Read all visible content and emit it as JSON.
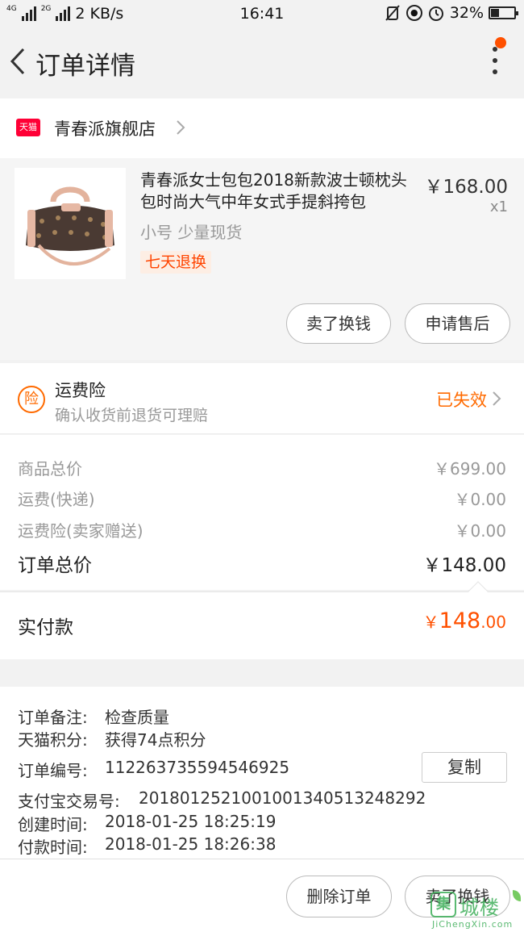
{
  "status_bar": {
    "network_left": "4G",
    "network_right": "2G",
    "speed": "2 KB/s",
    "time": "16:41",
    "battery": "32%",
    "icons": [
      "mute-icon",
      "rotation-lock-icon",
      "alarm-icon",
      "battery-icon"
    ]
  },
  "nav": {
    "title": "订单详情",
    "back_icon": "chevron-left-icon",
    "more_icon": "more-vertical-icon",
    "badge_color": "#ff5000"
  },
  "shop": {
    "logo_text": "天猫",
    "name": "青春派旗舰店"
  },
  "product": {
    "title": "青春派女士包包2018新款波士顿枕头包时尚大气中年女式手提斜挎包",
    "price": "￥168.00",
    "quantity": "x1",
    "sku": "小号 少量现货",
    "tag": "七天退换",
    "buttons": [
      "卖了换钱",
      "申请售后"
    ]
  },
  "insurance": {
    "icon_text": "险",
    "title": "运费险",
    "subtitle": "确认收货前退货可理赔",
    "status": "已失效"
  },
  "totals": {
    "rows": [
      {
        "label": "商品总价",
        "value": "￥699.00"
      },
      {
        "label": "运费(快递)",
        "value": "￥0.00"
      },
      {
        "label": "运费险(卖家赠送)",
        "value": "￥0.00"
      }
    ],
    "order_total_label": "订单总价",
    "order_total_value": "￥148.00",
    "paid_label": "实付款",
    "paid_currency": "￥",
    "paid_int": "148",
    "paid_dec": ".00"
  },
  "order_info": {
    "note_label": "订单备注:",
    "note_value": "检查质量",
    "points_label": "天猫积分:",
    "points_value": "获得74点积分",
    "order_no_label": "订单编号:",
    "order_no_value": "112263735594546925",
    "copy_label": "复制",
    "alipay_label": "支付宝交易号:",
    "alipay_value": "2018012521001001340513248292",
    "created_label": "创建时间:",
    "created_value": "2018-01-25 18:25:19",
    "paid_time_label": "付款时间:",
    "paid_time_value": "2018-01-25 18:26:38"
  },
  "bottom_bar": {
    "buttons": [
      "删除订单",
      "卖了换钱"
    ]
  },
  "watermark": {
    "text": "城楼",
    "sub": "JiChengXin.com"
  },
  "colors": {
    "accent": "#ff5000",
    "tmall_red": "#ff0036",
    "watermark_green": "#3fae5a"
  }
}
